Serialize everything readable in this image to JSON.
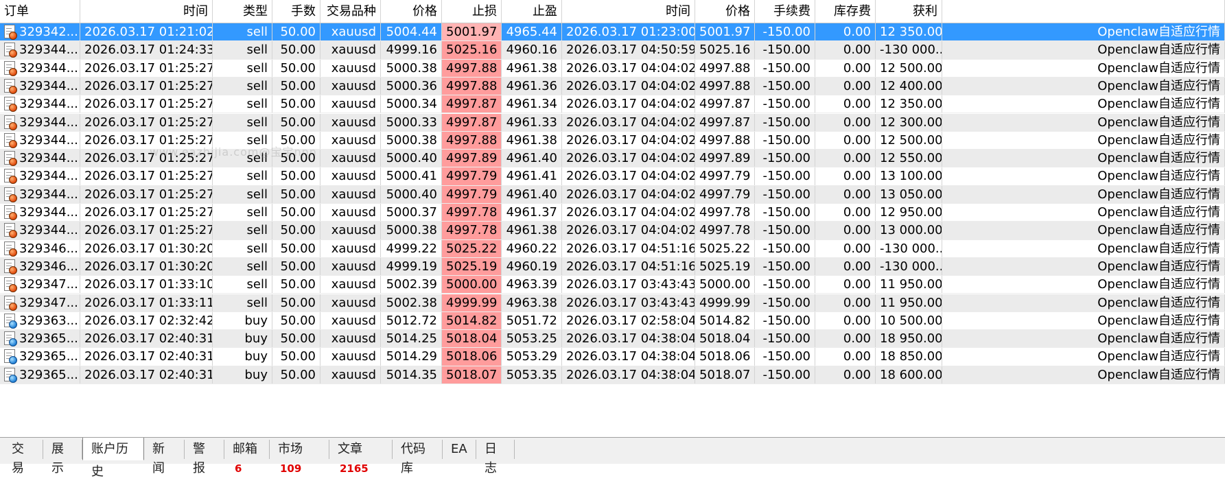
{
  "columns": [
    "订单",
    "时间",
    "类型",
    "手数",
    "交易品种",
    "价格",
    "止损",
    "止盈",
    "时间",
    "价格",
    "手续费",
    "库存费",
    "获利",
    ""
  ],
  "rows": [
    {
      "order": "329342...",
      "open_time": "2026.03.17 01:21:02",
      "type": "sell",
      "lots": "50.00",
      "symbol": "xauusd",
      "price": "5004.44",
      "sl": "5001.97",
      "tp": "4965.44",
      "close_time": "2026.03.17 01:23:00",
      "close_price": "5001.97",
      "commission": "-150.00",
      "swap": "0.00",
      "profit": "12 350.00",
      "comment": "Openclaw自适应行情"
    },
    {
      "order": "329344...",
      "open_time": "2026.03.17 01:24:33",
      "type": "sell",
      "lots": "50.00",
      "symbol": "xauusd",
      "price": "4999.16",
      "sl": "5025.16",
      "tp": "4960.16",
      "close_time": "2026.03.17 04:50:59",
      "close_price": "5025.16",
      "commission": "-150.00",
      "swap": "0.00",
      "profit": "-130 000...",
      "comment": "Openclaw自适应行情"
    },
    {
      "order": "329344...",
      "open_time": "2026.03.17 01:25:27",
      "type": "sell",
      "lots": "50.00",
      "symbol": "xauusd",
      "price": "5000.38",
      "sl": "4997.88",
      "tp": "4961.38",
      "close_time": "2026.03.17 04:04:02",
      "close_price": "4997.88",
      "commission": "-150.00",
      "swap": "0.00",
      "profit": "12 500.00",
      "comment": "Openclaw自适应行情"
    },
    {
      "order": "329344...",
      "open_time": "2026.03.17 01:25:27",
      "type": "sell",
      "lots": "50.00",
      "symbol": "xauusd",
      "price": "5000.36",
      "sl": "4997.88",
      "tp": "4961.36",
      "close_time": "2026.03.17 04:04:02",
      "close_price": "4997.88",
      "commission": "-150.00",
      "swap": "0.00",
      "profit": "12 400.00",
      "comment": "Openclaw自适应行情"
    },
    {
      "order": "329344...",
      "open_time": "2026.03.17 01:25:27",
      "type": "sell",
      "lots": "50.00",
      "symbol": "xauusd",
      "price": "5000.34",
      "sl": "4997.87",
      "tp": "4961.34",
      "close_time": "2026.03.17 04:04:02",
      "close_price": "4997.87",
      "commission": "-150.00",
      "swap": "0.00",
      "profit": "12 350.00",
      "comment": "Openclaw自适应行情"
    },
    {
      "order": "329344...",
      "open_time": "2026.03.17 01:25:27",
      "type": "sell",
      "lots": "50.00",
      "symbol": "xauusd",
      "price": "5000.33",
      "sl": "4997.87",
      "tp": "4961.33",
      "close_time": "2026.03.17 04:04:02",
      "close_price": "4997.87",
      "commission": "-150.00",
      "swap": "0.00",
      "profit": "12 300.00",
      "comment": "Openclaw自适应行情"
    },
    {
      "order": "329344...",
      "open_time": "2026.03.17 01:25:27",
      "type": "sell",
      "lots": "50.00",
      "symbol": "xauusd",
      "price": "5000.38",
      "sl": "4997.88",
      "tp": "4961.38",
      "close_time": "2026.03.17 04:04:02",
      "close_price": "4997.88",
      "commission": "-150.00",
      "swap": "0.00",
      "profit": "12 500.00",
      "comment": "Openclaw自适应行情"
    },
    {
      "order": "329344...",
      "open_time": "2026.03.17 01:25:27",
      "type": "sell",
      "lots": "50.00",
      "symbol": "xauusd",
      "price": "5000.40",
      "sl": "4997.89",
      "tp": "4961.40",
      "close_time": "2026.03.17 04:04:02",
      "close_price": "4997.89",
      "commission": "-150.00",
      "swap": "0.00",
      "profit": "12 550.00",
      "comment": "Openclaw自适应行情"
    },
    {
      "order": "329344...",
      "open_time": "2026.03.17 01:25:27",
      "type": "sell",
      "lots": "50.00",
      "symbol": "xauusd",
      "price": "5000.41",
      "sl": "4997.79",
      "tp": "4961.41",
      "close_time": "2026.03.17 04:04:02",
      "close_price": "4997.79",
      "commission": "-150.00",
      "swap": "0.00",
      "profit": "13 100.00",
      "comment": "Openclaw自适应行情"
    },
    {
      "order": "329344...",
      "open_time": "2026.03.17 01:25:27",
      "type": "sell",
      "lots": "50.00",
      "symbol": "xauusd",
      "price": "5000.40",
      "sl": "4997.79",
      "tp": "4961.40",
      "close_time": "2026.03.17 04:04:02",
      "close_price": "4997.79",
      "commission": "-150.00",
      "swap": "0.00",
      "profit": "13 050.00",
      "comment": "Openclaw自适应行情"
    },
    {
      "order": "329344...",
      "open_time": "2026.03.17 01:25:27",
      "type": "sell",
      "lots": "50.00",
      "symbol": "xauusd",
      "price": "5000.37",
      "sl": "4997.78",
      "tp": "4961.37",
      "close_time": "2026.03.17 04:04:02",
      "close_price": "4997.78",
      "commission": "-150.00",
      "swap": "0.00",
      "profit": "12 950.00",
      "comment": "Openclaw自适应行情"
    },
    {
      "order": "329344...",
      "open_time": "2026.03.17 01:25:27",
      "type": "sell",
      "lots": "50.00",
      "symbol": "xauusd",
      "price": "5000.38",
      "sl": "4997.78",
      "tp": "4961.38",
      "close_time": "2026.03.17 04:04:02",
      "close_price": "4997.78",
      "commission": "-150.00",
      "swap": "0.00",
      "profit": "13 000.00",
      "comment": "Openclaw自适应行情"
    },
    {
      "order": "329346...",
      "open_time": "2026.03.17 01:30:20",
      "type": "sell",
      "lots": "50.00",
      "symbol": "xauusd",
      "price": "4999.22",
      "sl": "5025.22",
      "tp": "4960.22",
      "close_time": "2026.03.17 04:51:16",
      "close_price": "5025.22",
      "commission": "-150.00",
      "swap": "0.00",
      "profit": "-130 000...",
      "comment": "Openclaw自适应行情"
    },
    {
      "order": "329346...",
      "open_time": "2026.03.17 01:30:20",
      "type": "sell",
      "lots": "50.00",
      "symbol": "xauusd",
      "price": "4999.19",
      "sl": "5025.19",
      "tp": "4960.19",
      "close_time": "2026.03.17 04:51:16",
      "close_price": "5025.19",
      "commission": "-150.00",
      "swap": "0.00",
      "profit": "-130 000...",
      "comment": "Openclaw自适应行情"
    },
    {
      "order": "329347...",
      "open_time": "2026.03.17 01:33:10",
      "type": "sell",
      "lots": "50.00",
      "symbol": "xauusd",
      "price": "5002.39",
      "sl": "5000.00",
      "tp": "4963.39",
      "close_time": "2026.03.17 03:43:43",
      "close_price": "5000.00",
      "commission": "-150.00",
      "swap": "0.00",
      "profit": "11 950.00",
      "comment": "Openclaw自适应行情"
    },
    {
      "order": "329347...",
      "open_time": "2026.03.17 01:33:11",
      "type": "sell",
      "lots": "50.00",
      "symbol": "xauusd",
      "price": "5002.38",
      "sl": "4999.99",
      "tp": "4963.38",
      "close_time": "2026.03.17 03:43:43",
      "close_price": "4999.99",
      "commission": "-150.00",
      "swap": "0.00",
      "profit": "11 950.00",
      "comment": "Openclaw自适应行情"
    },
    {
      "order": "329363...",
      "open_time": "2026.03.17 02:32:42",
      "type": "buy",
      "lots": "50.00",
      "symbol": "xauusd",
      "price": "5012.72",
      "sl": "5014.82",
      "tp": "5051.72",
      "close_time": "2026.03.17 02:58:04",
      "close_price": "5014.82",
      "commission": "-150.00",
      "swap": "0.00",
      "profit": "10 500.00",
      "comment": "Openclaw自适应行情"
    },
    {
      "order": "329365...",
      "open_time": "2026.03.17 02:40:31",
      "type": "buy",
      "lots": "50.00",
      "symbol": "xauusd",
      "price": "5014.25",
      "sl": "5018.04",
      "tp": "5053.25",
      "close_time": "2026.03.17 04:38:04",
      "close_price": "5018.04",
      "commission": "-150.00",
      "swap": "0.00",
      "profit": "18 950.00",
      "comment": "Openclaw自适应行情"
    },
    {
      "order": "329365...",
      "open_time": "2026.03.17 02:40:31",
      "type": "buy",
      "lots": "50.00",
      "symbol": "xauusd",
      "price": "5014.29",
      "sl": "5018.06",
      "tp": "5053.29",
      "close_time": "2026.03.17 04:38:04",
      "close_price": "5018.06",
      "commission": "-150.00",
      "swap": "0.00",
      "profit": "18 850.00",
      "comment": "Openclaw自适应行情"
    },
    {
      "order": "329365...",
      "open_time": "2026.03.17 02:40:31",
      "type": "buy",
      "lots": "50.00",
      "symbol": "xauusd",
      "price": "5014.35",
      "sl": "5018.07",
      "tp": "5053.35",
      "close_time": "2026.03.17 04:38:04",
      "close_price": "5018.07",
      "commission": "-150.00",
      "swap": "0.00",
      "profit": "18 600.00",
      "comment": "Openclaw自适应行情"
    }
  ],
  "selected_row": 0,
  "watermark": "www.eazhijia.com@宝宝nnn",
  "tabs": [
    {
      "label": "交易",
      "badge": ""
    },
    {
      "label": "展示",
      "badge": ""
    },
    {
      "label": "账户历史",
      "badge": ""
    },
    {
      "label": "新闻",
      "badge": ""
    },
    {
      "label": "警报",
      "badge": ""
    },
    {
      "label": "邮箱",
      "badge": "6"
    },
    {
      "label": "市场",
      "badge": "109"
    },
    {
      "label": "文章",
      "badge": "2165"
    },
    {
      "label": "代码库",
      "badge": ""
    },
    {
      "label": "EA",
      "badge": ""
    },
    {
      "label": "日志",
      "badge": ""
    }
  ],
  "active_tab": 2,
  "colors": {
    "selection": "#3399ff",
    "stoploss_highlight": "#ff9c9c",
    "badge": "#e00000",
    "sell_icon": "#e0480b",
    "buy_icon": "#1e7fd6"
  }
}
